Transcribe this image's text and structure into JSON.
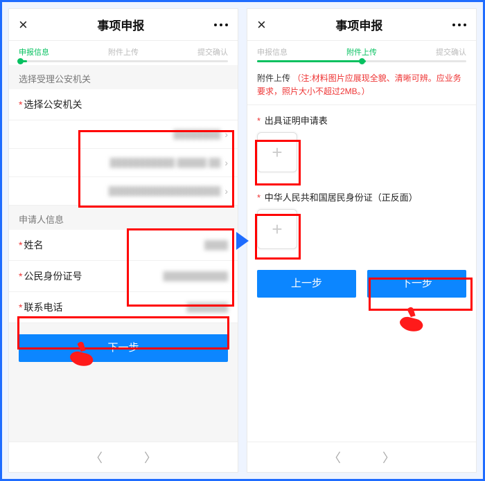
{
  "left": {
    "header": {
      "title": "事项申报"
    },
    "steps": [
      "申报信息",
      "附件上传",
      "提交确认"
    ],
    "progress_fill_pct": 4,
    "progress_dot_pct": 0,
    "section_agency": "选择受理公安机关",
    "row_select_agency_label": "选择公安机关",
    "picker_rows": [
      {
        "masked": "████████"
      },
      {
        "masked": "███████████ █████ ██"
      },
      {
        "masked": "███████████████████"
      }
    ],
    "section_applicant": "申请人信息",
    "applicant": {
      "name_label": "姓名",
      "id_label": "公民身份证号",
      "phone_label": "联系电话",
      "name_val": "████",
      "id_val": "███████████",
      "phone_val": "███████"
    },
    "next_btn": "下一步"
  },
  "right": {
    "header": {
      "title": "事项申报"
    },
    "steps": [
      "申报信息",
      "附件上传",
      "提交确认"
    ],
    "progress_fill_pct": 52,
    "progress_dot_pct": 50,
    "hint_label": "附件上传",
    "hint_note": "（注:材料图片应展现全貌、清晰可辨。应业务要求，照片大小不超过2MB。）",
    "field1_label": "出具证明申请表",
    "field2_label": "中华人民共和国居民身份证（正反面）",
    "prev_btn": "上一步",
    "next_btn": "下一步"
  }
}
